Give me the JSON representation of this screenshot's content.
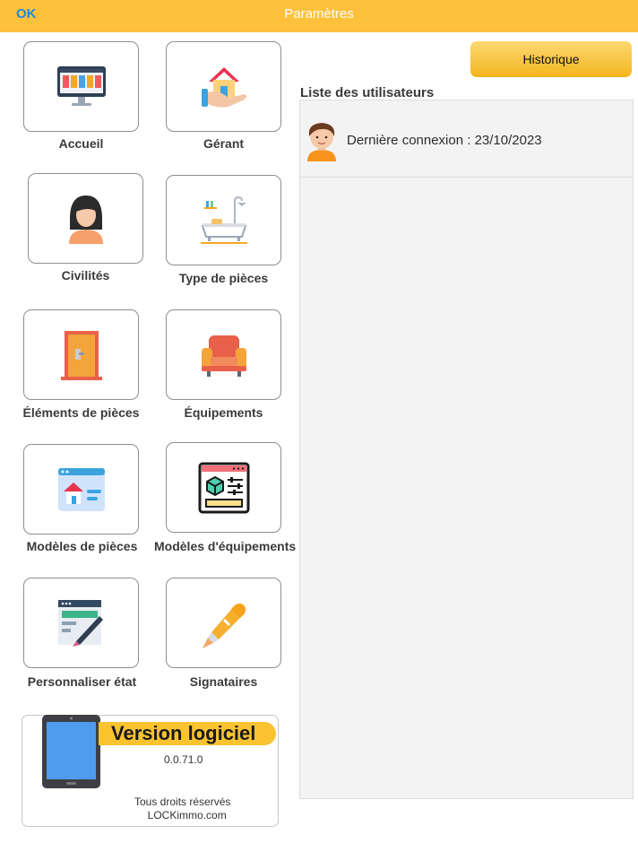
{
  "header": {
    "ok_label": "OK",
    "title": "Paramètres"
  },
  "tiles": [
    {
      "label": "Accueil",
      "icon": "computer-monitor-icon"
    },
    {
      "label": "Gérant",
      "icon": "house-in-hand-icon"
    },
    {
      "label": "Civilités",
      "icon": "woman-avatar-icon"
    },
    {
      "label": "Type de pièces",
      "icon": "bathtub-icon"
    },
    {
      "label": "Éléments de pièces",
      "icon": "door-icon"
    },
    {
      "label": "Équipements",
      "icon": "armchair-icon"
    },
    {
      "label": "Modèles de pièces",
      "icon": "house-window-icon"
    },
    {
      "label": "Modèles d'équipements",
      "icon": "cube-settings-icon"
    },
    {
      "label": "Personnaliser état",
      "icon": "design-pen-icon"
    },
    {
      "label": "Signataires",
      "icon": "fountain-pen-icon"
    }
  ],
  "history": {
    "button_label": "Historique"
  },
  "users": {
    "title": "Liste des utilisateurs",
    "items": [
      {
        "last_login": "Dernière connexion : 23/10/2023",
        "icon": "man-avatar-icon"
      }
    ]
  },
  "version": {
    "title": "Version logiciel",
    "number": "0.0.71.0",
    "rights": "Tous droits réservés",
    "site": "LOCKimmo.com"
  },
  "colors": {
    "accent": "#FDC13C",
    "ok_blue": "#1e88e5"
  }
}
